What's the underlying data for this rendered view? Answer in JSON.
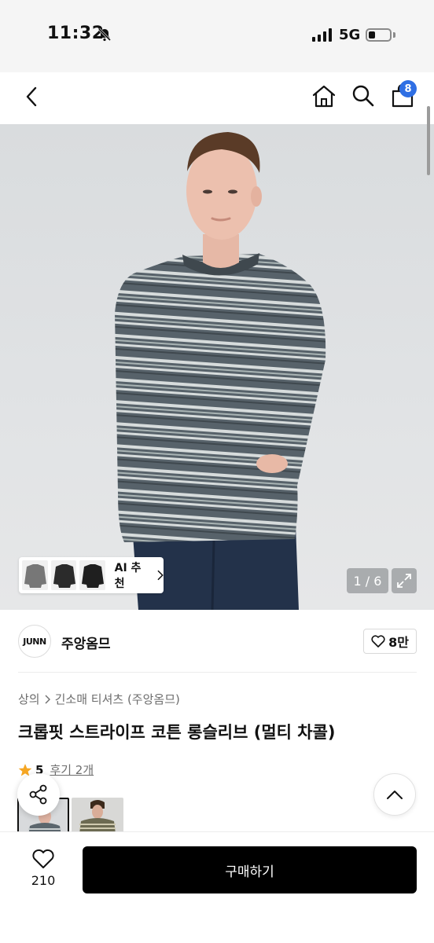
{
  "status_bar": {
    "time": "11:32",
    "network": "5G",
    "battery_level": 0.2
  },
  "nav": {
    "cart_count": "8"
  },
  "gallery": {
    "ai_recommend_label": "AI 추천",
    "page_indicator": "1 / 6"
  },
  "brand": {
    "logo_text": "JUNN",
    "name": "주앙옴므",
    "likes": "8만"
  },
  "breadcrumb": {
    "category": "상의",
    "subcategory": "긴소매 티셔츠 (주앙옴므)"
  },
  "product": {
    "title": "크롭핏 스트라이프 코튼 롱슬리브 (멀티 차콜)",
    "rating": "5",
    "reviews": "후기 2개"
  },
  "bottom_bar": {
    "wish_count": "210",
    "buy_label": "구매하기"
  },
  "colors": {
    "accent": "#2f6fe4",
    "star": "#f5a623",
    "stripe_dark": "#4f5a62",
    "stripe_light": "#d6dbdc"
  }
}
